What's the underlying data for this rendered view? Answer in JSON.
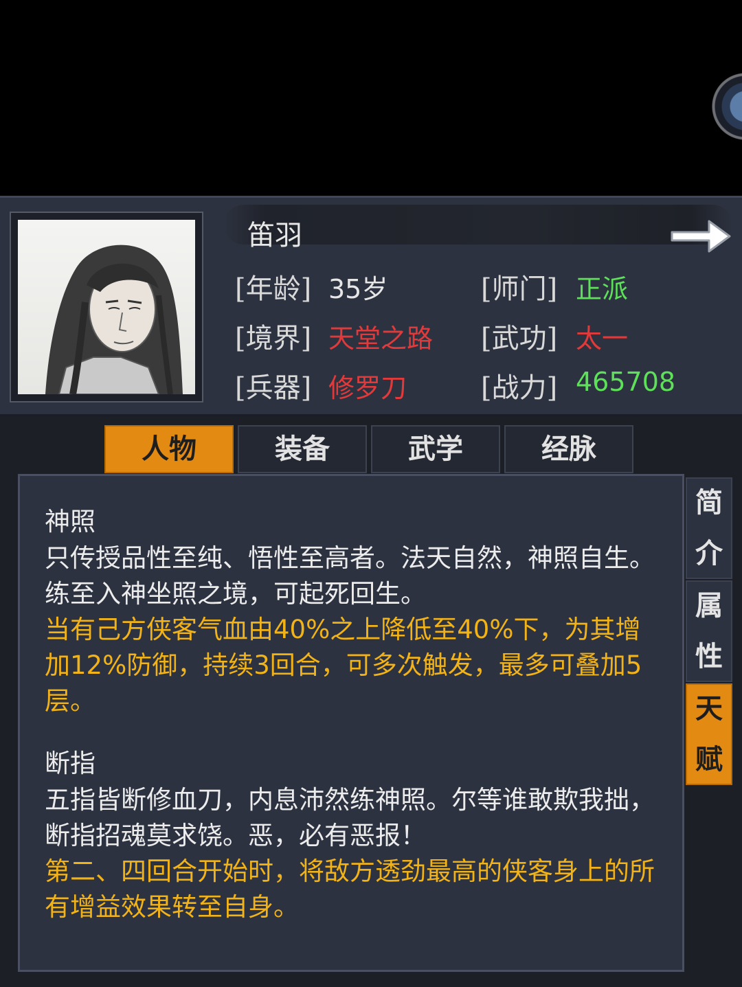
{
  "character": {
    "name": "笛羽",
    "stats": [
      {
        "label": "[年龄]",
        "value": "35岁",
        "color": "#e6e6e6"
      },
      {
        "label": "[师门]",
        "value": "正派",
        "color": "#5ee05a"
      },
      {
        "label": "[境界]",
        "value": "天堂之路",
        "color": "#e23a3a"
      },
      {
        "label": "[武功]",
        "value": "太一",
        "color": "#e23a3a"
      },
      {
        "label": "[兵器]",
        "value": "修罗刀",
        "color": "#e23a3a"
      },
      {
        "label": "[战力]",
        "value": "465708",
        "color": "#5ee05a"
      }
    ]
  },
  "tabs": [
    "人物",
    "装备",
    "武学",
    "经脉"
  ],
  "active_tab": "人物",
  "side_tabs": [
    "简介",
    "属性",
    "天赋"
  ],
  "active_side_tab": "天赋",
  "talents": [
    {
      "name": "神照",
      "desc": "只传授品性至纯、悟性至高者。法天自然，神照自生。练至入神坐照之境，可起死回生。",
      "effect": "当有己方侠客气血由40%之上降低至40%下，为其增加12%防御，持续3回合，可多次触发，最多可叠加5层。"
    },
    {
      "name": "断指",
      "desc": "五指皆断修血刀，内息沛然练神照。尔等谁敢欺我拙，断指招魂莫求饶。恶，必有恶报！",
      "effect": "第二、四回合开始时，将敌方透劲最高的侠客身上的所有增益效果转至自身。"
    }
  ],
  "colors": {
    "accent": "#e38a12",
    "effect_text": "#f2b318",
    "panel": "#2d3240"
  }
}
